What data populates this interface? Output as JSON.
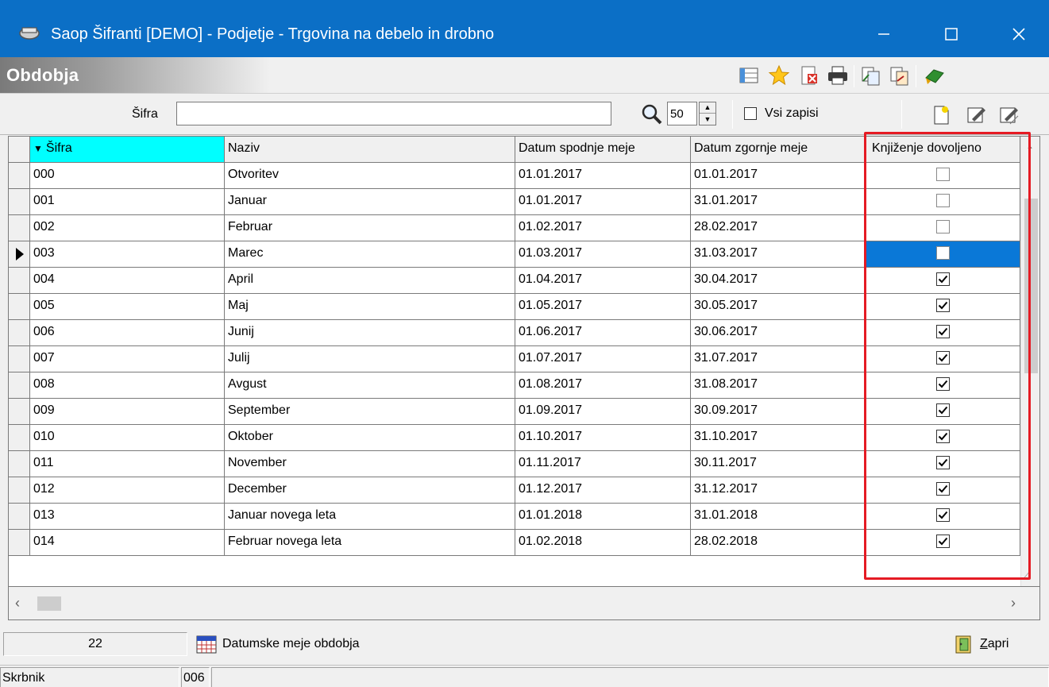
{
  "window": {
    "title": "Saop Šifranti [DEMO] - Podjetje - Trgovina na debelo in drobno",
    "minimize_glyph": "—",
    "maximize_glyph": "☐",
    "close_glyph": "✕"
  },
  "header": {
    "title": "Obdobja",
    "toolbar_icons": [
      "grid-settings-icon",
      "favorite-star-icon",
      "excel-export-icon",
      "print-icon",
      "copy-record-icon",
      "paste-record-icon",
      "exit-icon"
    ]
  },
  "filter": {
    "sifra_label": "Šifra",
    "sifra_value": "",
    "count_value": "50",
    "all_records_label": "Vsi zapisi",
    "all_records_checked": false,
    "record_icons": [
      "new-record-icon",
      "edit-record-icon",
      "edit-all-icon"
    ]
  },
  "grid": {
    "columns": [
      "Šifra",
      "Naziv",
      "Datum spodnje meje",
      "Datum zgornje meje",
      "Knjiženje dovoljeno"
    ],
    "sorted_column": "Šifra",
    "selected_row": 3,
    "rows": [
      {
        "sifra": "000",
        "naziv": "Otvoritev",
        "od": "01.01.2017",
        "do": "01.01.2017",
        "knjizenje": false
      },
      {
        "sifra": "001",
        "naziv": "Januar",
        "od": "01.01.2017",
        "do": "31.01.2017",
        "knjizenje": false
      },
      {
        "sifra": "002",
        "naziv": "Februar",
        "od": "01.02.2017",
        "do": "28.02.2017",
        "knjizenje": false
      },
      {
        "sifra": "003",
        "naziv": "Marec",
        "od": "01.03.2017",
        "do": "31.03.2017",
        "knjizenje": false
      },
      {
        "sifra": "004",
        "naziv": "April",
        "od": "01.04.2017",
        "do": "30.04.2017",
        "knjizenje": true
      },
      {
        "sifra": "005",
        "naziv": "Maj",
        "od": "01.05.2017",
        "do": "30.05.2017",
        "knjizenje": true
      },
      {
        "sifra": "006",
        "naziv": "Junij",
        "od": "01.06.2017",
        "do": "30.06.2017",
        "knjizenje": true
      },
      {
        "sifra": "007",
        "naziv": "Julij",
        "od": "01.07.2017",
        "do": "31.07.2017",
        "knjizenje": true
      },
      {
        "sifra": "008",
        "naziv": "Avgust",
        "od": "01.08.2017",
        "do": "31.08.2017",
        "knjizenje": true
      },
      {
        "sifra": "009",
        "naziv": "September",
        "od": "01.09.2017",
        "do": "30.09.2017",
        "knjizenje": true
      },
      {
        "sifra": "010",
        "naziv": "Oktober",
        "od": "01.10.2017",
        "do": "31.10.2017",
        "knjizenje": true
      },
      {
        "sifra": "011",
        "naziv": "November",
        "od": "01.11.2017",
        "do": "30.11.2017",
        "knjizenje": true
      },
      {
        "sifra": "012",
        "naziv": "December",
        "od": "01.12.2017",
        "do": "31.12.2017",
        "knjizenje": true
      },
      {
        "sifra": "013",
        "naziv": "Januar novega leta",
        "od": "01.01.2018",
        "do": "31.01.2018",
        "knjizenje": true
      },
      {
        "sifra": "014",
        "naziv": "Februar novega leta",
        "od": "01.02.2018",
        "do": "28.02.2018",
        "knjizenje": true
      }
    ]
  },
  "footer": {
    "record_count": "22",
    "datum_button": "Datumske meje obdobja",
    "close_button_accel": "Z",
    "close_button_rest": "apri"
  },
  "statusbar": {
    "user": "Skrbnik",
    "code": "006",
    "message": ""
  },
  "colors": {
    "titlebar": "#0b6fc6",
    "sorted_header": "#00ffff",
    "selection": "#0a78d7",
    "highlight": "#e51b24"
  }
}
